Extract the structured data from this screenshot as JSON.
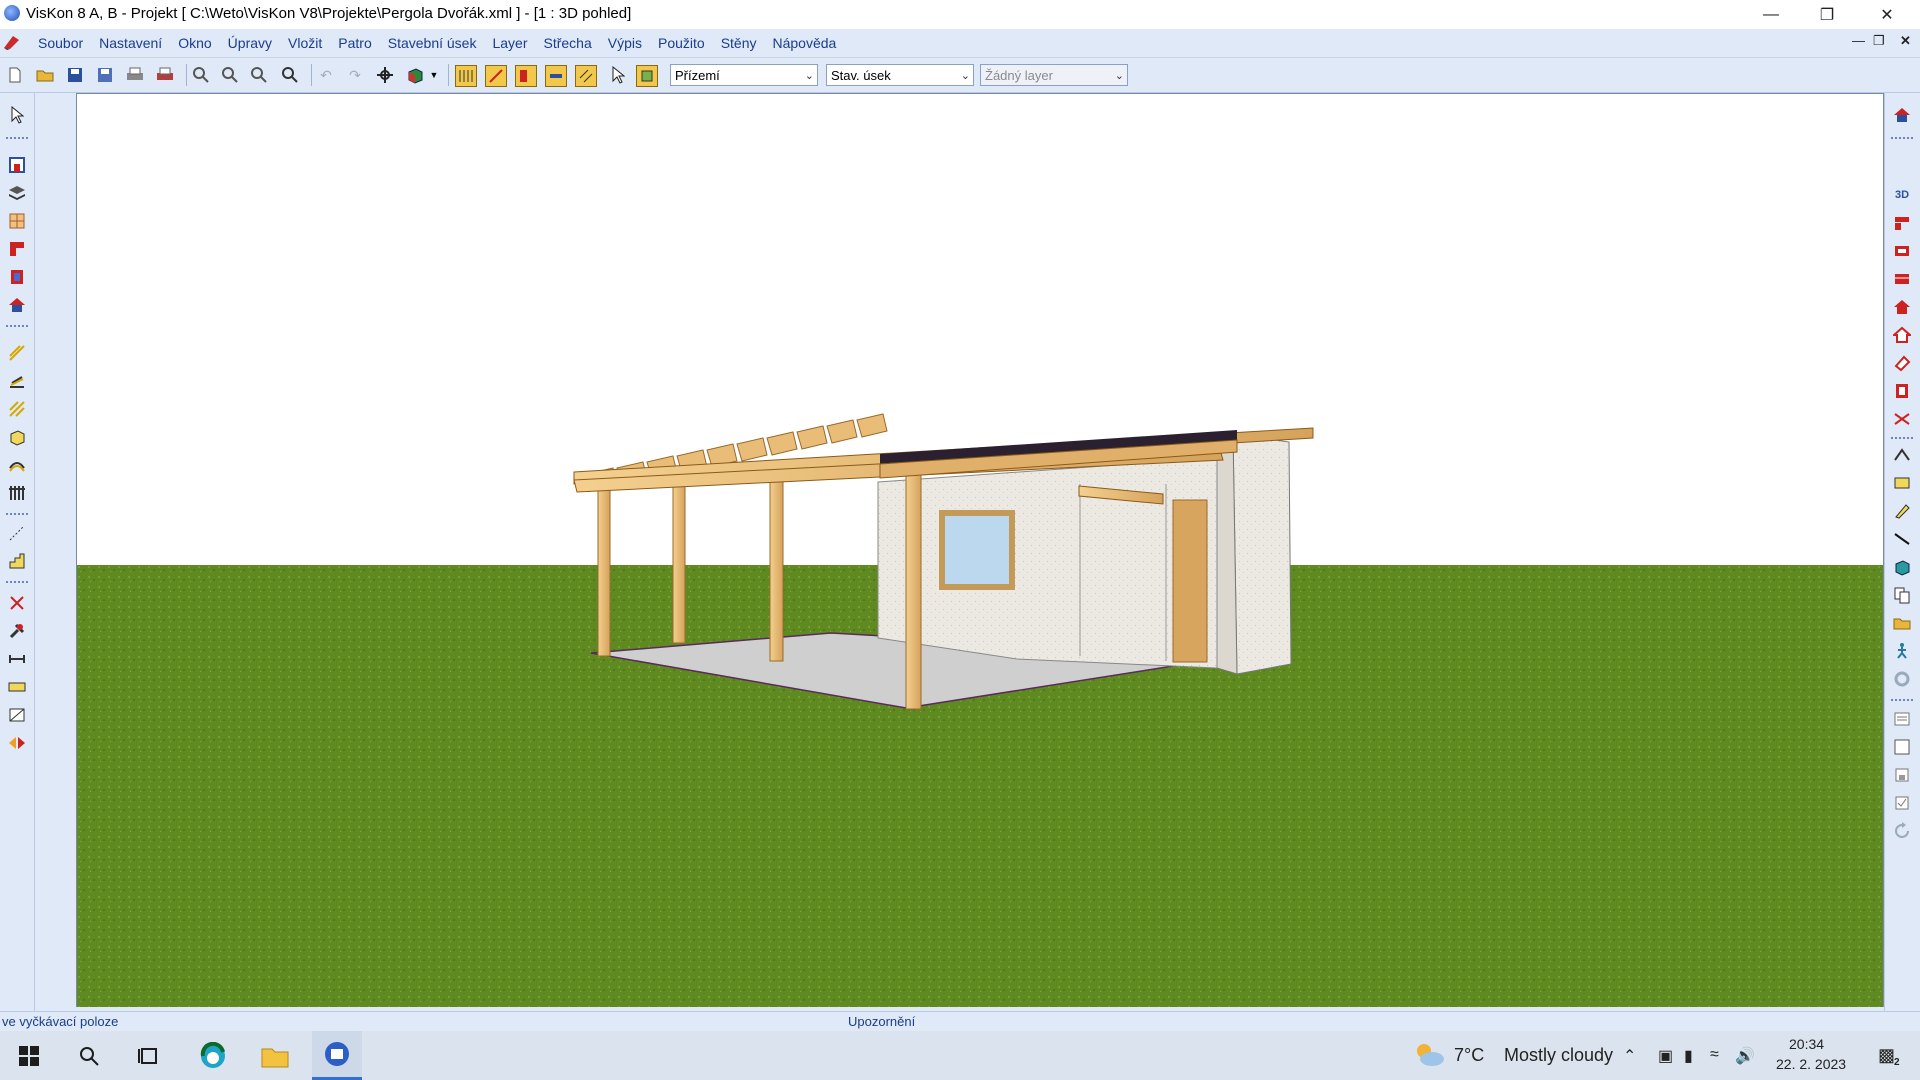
{
  "window": {
    "title": "VisKon 8 A, B - Projekt [ C:\\Weto\\VisKon V8\\Projekte\\Pergola Dvořák.xml ]  - [1 : 3D pohled]",
    "controls": [
      "minimize-icon",
      "restore-icon",
      "close-icon"
    ]
  },
  "menu": {
    "items": [
      "Soubor",
      "Nastavení",
      "Okno",
      "Úpravy",
      "Vložit",
      "Patro",
      "Stavební úsek",
      "Layer",
      "Střecha",
      "Výpis",
      "Použito",
      "Stěny",
      "Nápověda"
    ]
  },
  "toolbar": {
    "floor_select": "Přízemí",
    "section_select": "Stav. úsek",
    "layer_select": "Žádný layer"
  },
  "left_tools": [
    "select-arrow-icon",
    "window-icon",
    "layers-icon",
    "grid-icon",
    "wall-red-icon",
    "door-icon",
    "roof-red-icon",
    "line-yellow-icon",
    "stairs-icon",
    "beam-icon",
    "box-icon",
    "arc-icon",
    "rail-icon",
    "dashed-line-icon",
    "staircase-icon",
    "delete-x-icon",
    "tool-icon",
    "dimension-icon",
    "measure-icon",
    "hatch-icon",
    "mirror-icon"
  ],
  "right_tools": [
    "house-view-icon",
    "3d-icon",
    "section-red-icon",
    "stack-icon",
    "roof-icon",
    "house-red-icon",
    "house-outline-icon",
    "eraser-icon",
    "panel-icon",
    "cut-icon",
    "roof-edge-icon",
    "rect-yellow-icon",
    "pen-yellow-icon",
    "line-icon",
    "box-teal-icon",
    "copy-icon",
    "open-folder-icon",
    "walk-icon",
    "gear-icon",
    "list-icon",
    "square-icon",
    "square-small-icon",
    "checkbox-icon",
    "refresh-icon"
  ],
  "status": {
    "left": "ve vyčkávací poloze",
    "center": "Upozornění"
  },
  "taskbar": {
    "weather_temp": "7°C",
    "weather_desc": "Mostly cloudy",
    "time": "20:34",
    "date": "22. 2. 2023",
    "notification_count": "2"
  }
}
